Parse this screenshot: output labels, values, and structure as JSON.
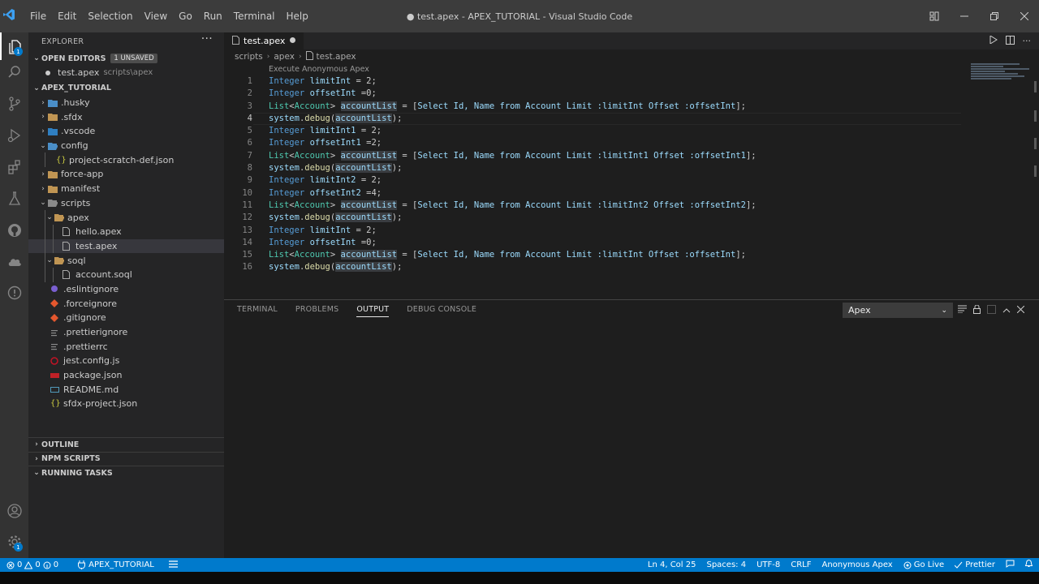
{
  "window": {
    "title": "● test.apex - APEX_TUTORIAL - Visual Studio Code",
    "menu": [
      "File",
      "Edit",
      "Selection",
      "View",
      "Go",
      "Run",
      "Terminal",
      "Help"
    ]
  },
  "activity_bar": {
    "explorer_badge": "1",
    "settings_badge": "1"
  },
  "sidebar": {
    "header": "EXPLORER",
    "open_editors": {
      "label": "OPEN EDITORS",
      "badge": "1 UNSAVED",
      "items": [
        {
          "name": "test.apex",
          "path": "scripts\\apex"
        }
      ]
    },
    "workspace": {
      "label": "APEX_TUTORIAL",
      "tree": [
        {
          "name": ".husky"
        },
        {
          "name": ".sfdx"
        },
        {
          "name": ".vscode"
        },
        {
          "name": "config"
        },
        {
          "name": "project-scratch-def.json"
        },
        {
          "name": "force-app"
        },
        {
          "name": "manifest"
        },
        {
          "name": "scripts"
        },
        {
          "name": "apex"
        },
        {
          "name": "hello.apex"
        },
        {
          "name": "test.apex"
        },
        {
          "name": "soql"
        },
        {
          "name": "account.soql"
        },
        {
          "name": ".eslintignore"
        },
        {
          "name": ".forceignore"
        },
        {
          "name": ".gitignore"
        },
        {
          "name": ".prettierignore"
        },
        {
          "name": ".prettierrc"
        },
        {
          "name": "jest.config.js"
        },
        {
          "name": "package.json"
        },
        {
          "name": "README.md"
        },
        {
          "name": "sfdx-project.json"
        }
      ]
    },
    "bottom_sections": [
      "OUTLINE",
      "NPM SCRIPTS",
      "RUNNING TASKS"
    ]
  },
  "editor": {
    "tab": "test.apex",
    "breadcrumb": [
      "scripts",
      "apex",
      "test.apex"
    ],
    "codelens": "Execute Anonymous Apex",
    "line_numbers": [
      "1",
      "2",
      "3",
      "4",
      "5",
      "6",
      "7",
      "8",
      "9",
      "10",
      "11",
      "12",
      "13",
      "14",
      "15",
      "16"
    ],
    "current_line": 4
  },
  "panel": {
    "tabs": [
      "TERMINAL",
      "PROBLEMS",
      "OUTPUT",
      "DEBUG CONSOLE"
    ],
    "active_tab": "OUTPUT",
    "output_channel": "Apex"
  },
  "status_bar": {
    "errors": "0",
    "warnings": "0",
    "info": "0",
    "workspace": "APEX_TUTORIAL",
    "position": "Ln 4, Col 25",
    "spaces": "Spaces: 4",
    "encoding": "UTF-8",
    "eol": "CRLF",
    "language": "Anonymous Apex",
    "go_live": "Go Live",
    "prettier": "Prettier"
  },
  "colors": {
    "status_bar": "#007acc",
    "keyword": "#569cd6",
    "type": "#4ec9b0",
    "variable": "#9cdcfe",
    "function": "#dcdcaa"
  }
}
